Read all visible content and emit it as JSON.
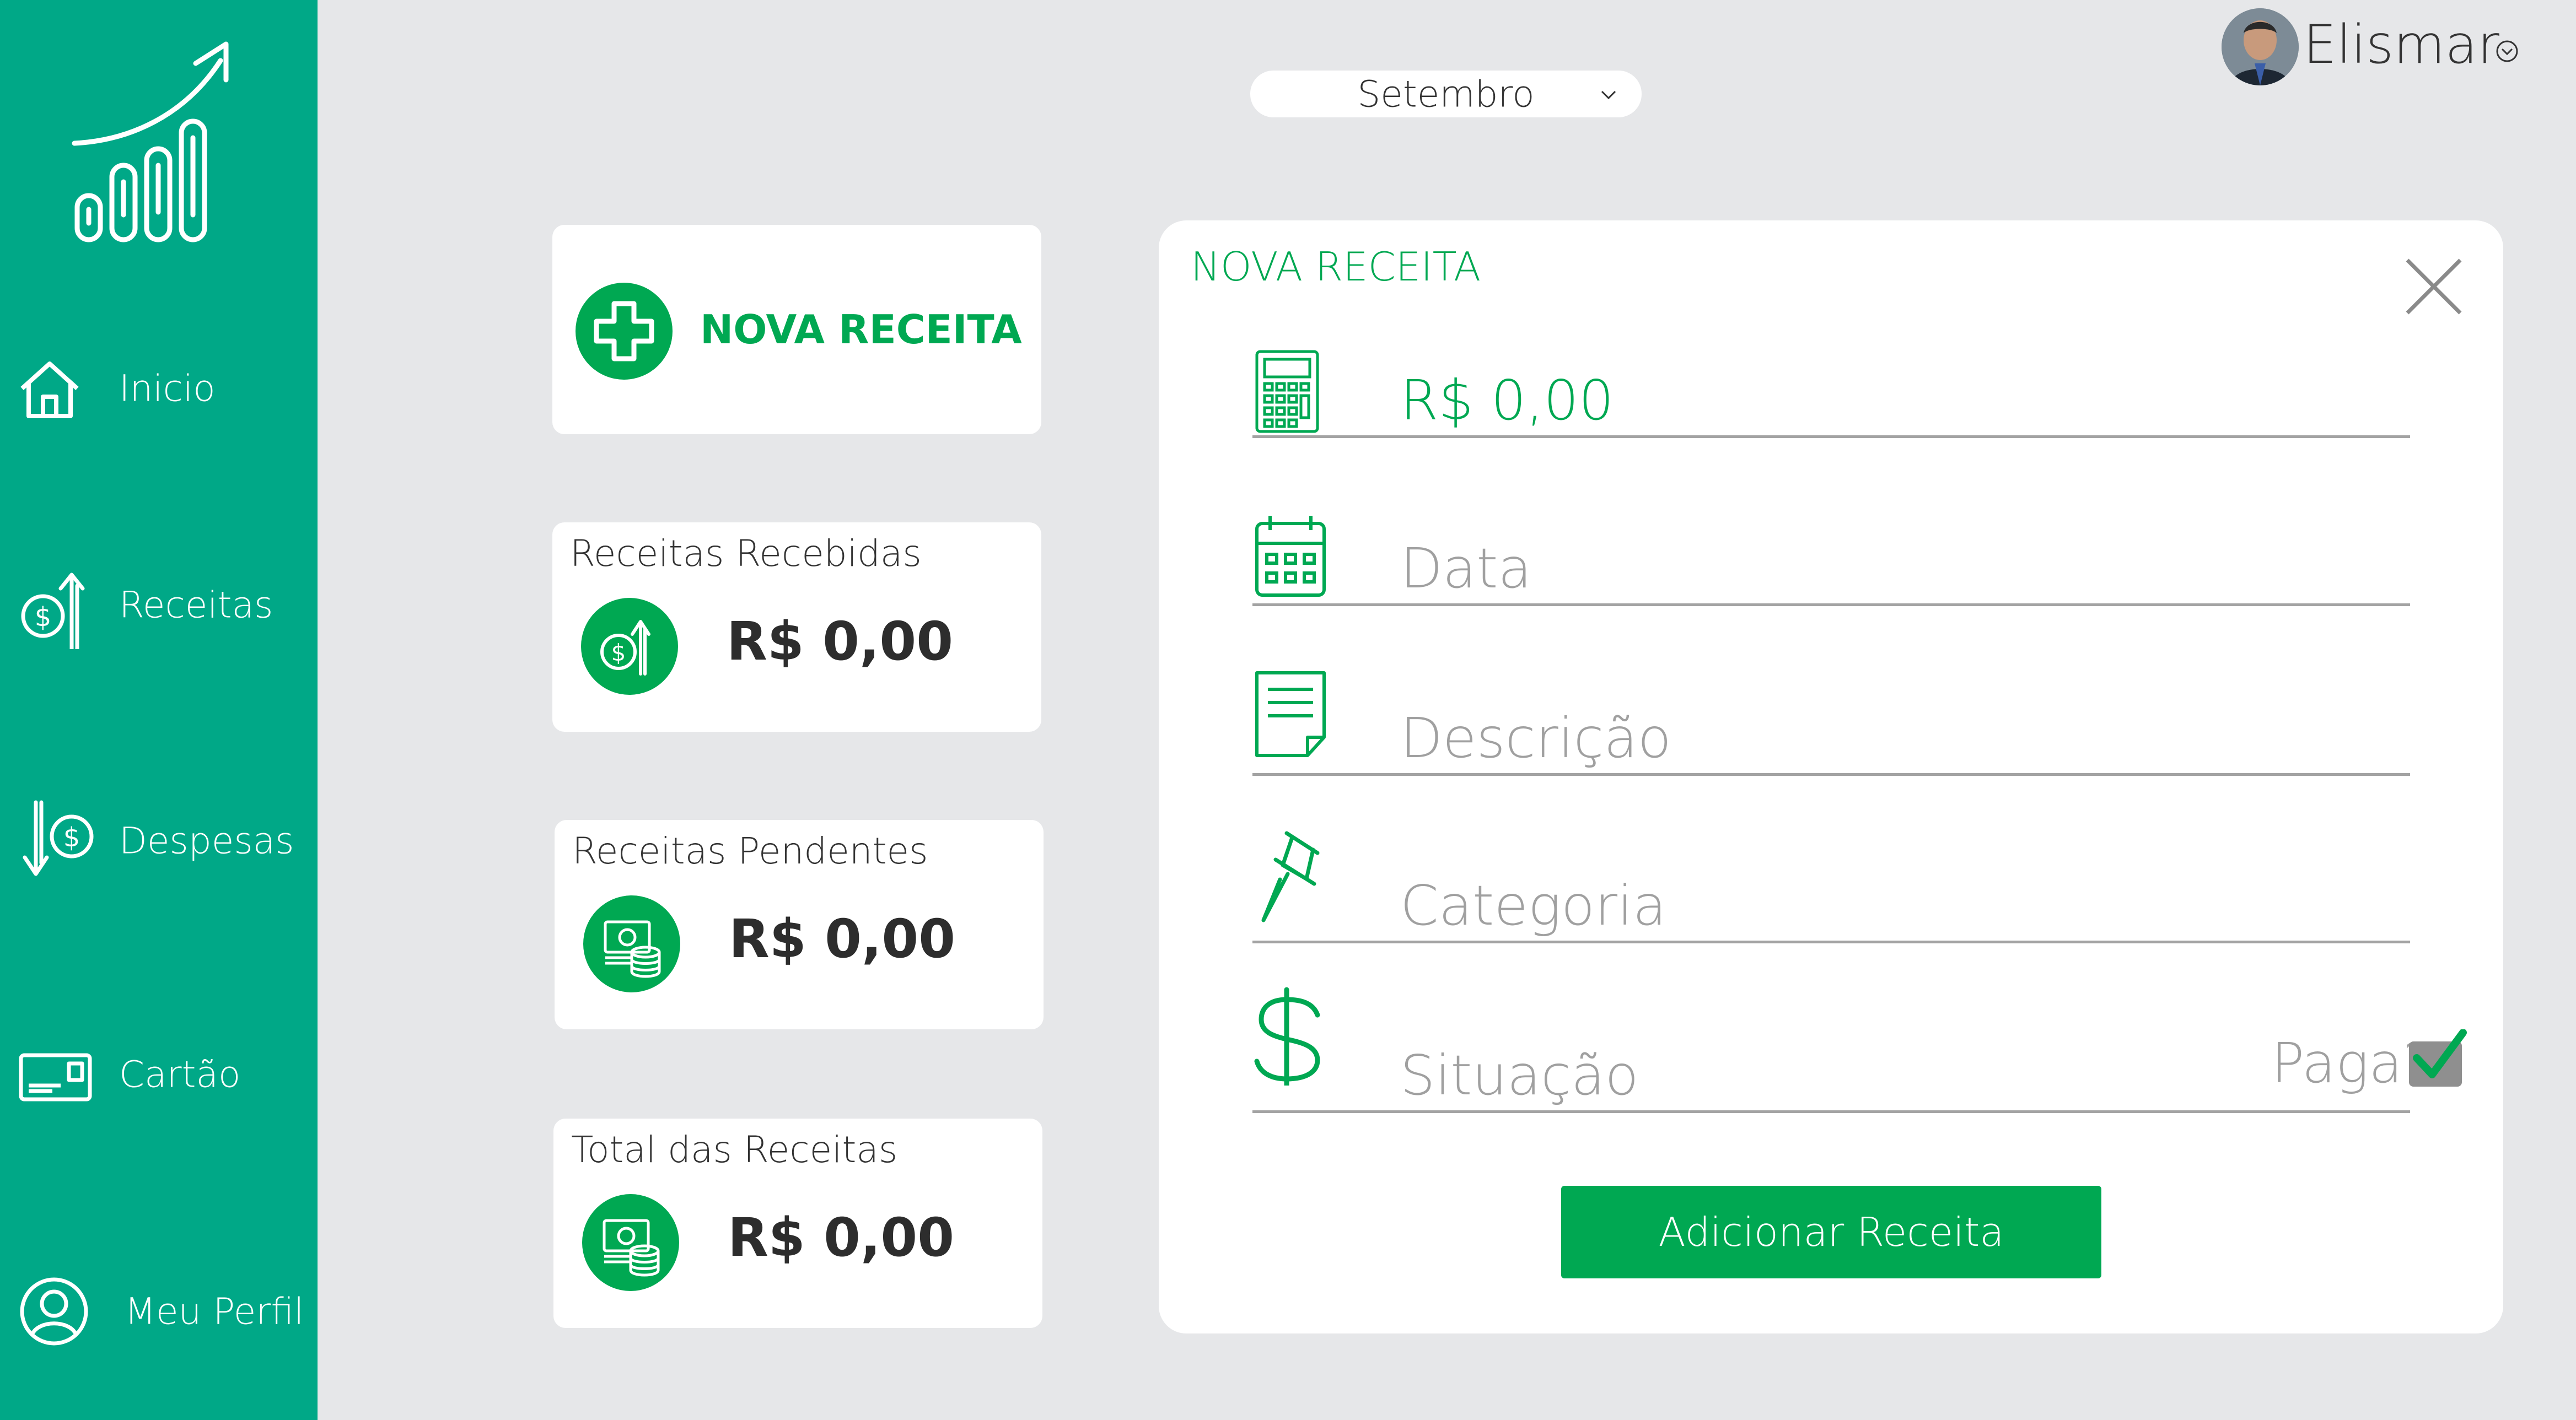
{
  "sidebar": {
    "items": [
      {
        "label": "Inicio",
        "icon": "home-icon"
      },
      {
        "label": "Receitas",
        "icon": "income-icon"
      },
      {
        "label": "Despesas",
        "icon": "expense-icon"
      },
      {
        "label": "Cartão",
        "icon": "card-icon"
      },
      {
        "label": "Meu Perfil",
        "icon": "profile-icon"
      }
    ]
  },
  "header": {
    "month": "Setembro",
    "user_name": "Elismar"
  },
  "cards": {
    "new_income": "NOVA RECEITA",
    "received": {
      "title": "Receitas Recebidas",
      "value": "R$ 0,00"
    },
    "pending": {
      "title": "Receitas Pendentes",
      "value": "R$ 0,00"
    },
    "total": {
      "title": "Total das Receitas",
      "value": "R$ 0,00"
    }
  },
  "form": {
    "title": "NOVA RECEITA",
    "value_field": "R$ 0,00",
    "date_placeholder": "Data",
    "description_placeholder": "Descrição",
    "category_placeholder": "Categoria",
    "status_label": "Situação",
    "paid_label": "Paga?",
    "paid_checked": true,
    "submit_label": "Adicionar Receita"
  },
  "colors": {
    "sidebar": "#00a887",
    "accent": "#00a852",
    "background": "#e6e7e9"
  }
}
